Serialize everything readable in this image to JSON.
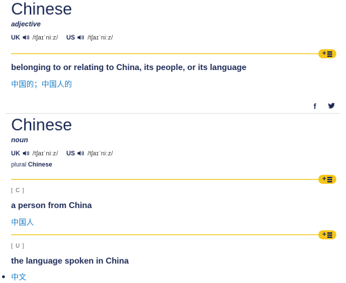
{
  "entries": [
    {
      "headword": "Chinese",
      "pos": "adjective",
      "uk_label": "UK",
      "uk_ipa": "/tʃaɪˈniːz/",
      "us_label": "US",
      "us_ipa": "/tʃaɪˈniːz/",
      "senses": [
        {
          "definition": "belonging to or relating to China, its people, or its language",
          "translation": "中国的；中国人的"
        }
      ]
    },
    {
      "headword": "Chinese",
      "pos": "noun",
      "uk_label": "UK",
      "uk_ipa": "/tʃaɪˈniːz/",
      "us_label": "US",
      "us_ipa": "/tʃaɪˈniːz/",
      "plural_label": "plural",
      "plural_form": "Chinese",
      "senses": [
        {
          "grammar": "[ C ]",
          "definition": "a person from China",
          "translation": "中国人"
        },
        {
          "grammar": "[ U ]",
          "definition": "the language spoken in China",
          "translation": "中文"
        }
      ]
    }
  ],
  "add_to_list_label": "+",
  "share": {
    "facebook": "f",
    "twitter": "y"
  },
  "colors": {
    "accent": "#f5c518",
    "headword": "#1d2a57",
    "translation": "#1a7fc7"
  },
  "icons": [
    "speaker-icon",
    "list-icon",
    "facebook-icon",
    "twitter-icon"
  ]
}
